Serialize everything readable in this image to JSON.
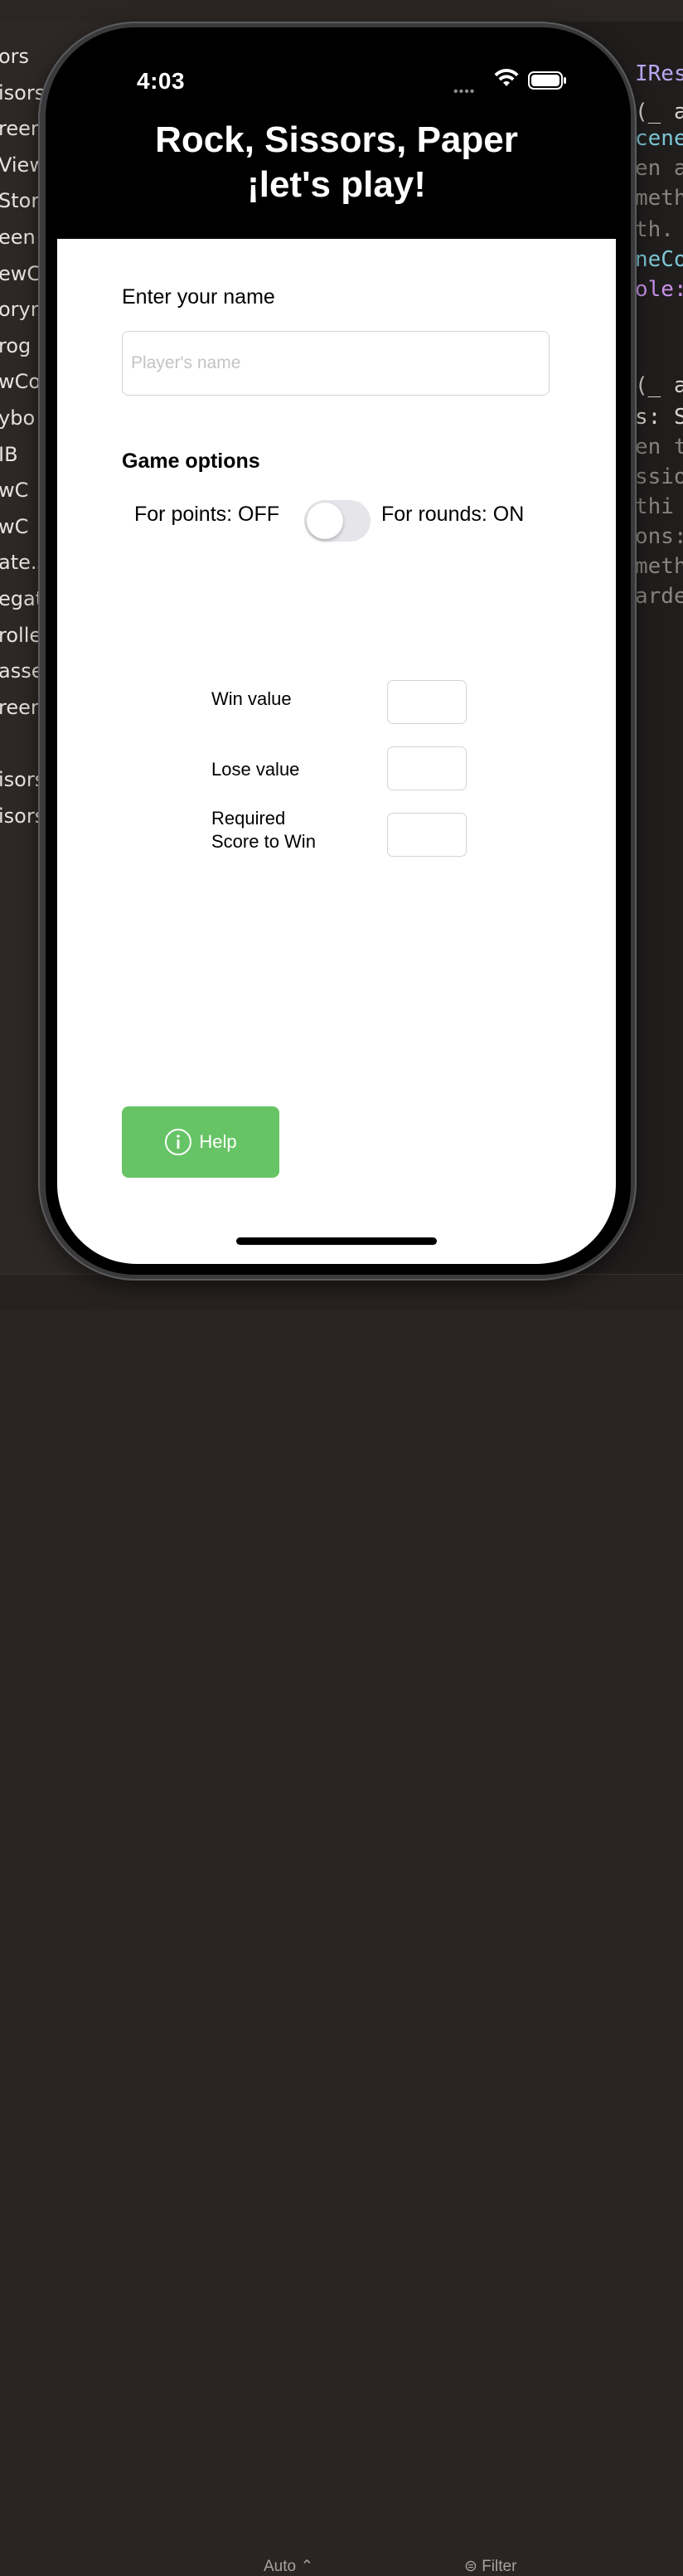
{
  "ide": {
    "file_items": [
      "ors",
      "isors",
      "reen",
      "View",
      "Story",
      "een",
      "ewC",
      "oryn",
      "rog",
      "wCo",
      "ybo",
      "IB",
      "wC",
      "wC",
      "ate.s",
      "egat",
      "rolle",
      "asse",
      "reen",
      "isors",
      "isors"
    ],
    "code_lines": [
      {
        "text": "IRes",
        "color": "#b8a7f2"
      },
      {
        "text": "(_ a",
        "color": "#d8d4d0"
      },
      {
        "text": "cene",
        "color": "#7cc7d6"
      },
      {
        "text": "en a",
        "color": "#8a8580"
      },
      {
        "text": "meth",
        "color": "#8a8580"
      },
      {
        "text": "th.",
        "color": "#8a8580"
      },
      {
        "text": "neCo",
        "color": "#7cc7d6"
      },
      {
        "text": "ole:",
        "color": "#c792ea"
      },
      {
        "text": "(_ a",
        "color": "#d8d4d0"
      },
      {
        "text": "s: S",
        "color": "#d8d4d0"
      },
      {
        "text": "en t",
        "color": "#8a8580"
      },
      {
        "text": "ssio",
        "color": "#8a8580"
      },
      {
        "text": "thi",
        "color": "#8a8580"
      },
      {
        "text": "ons:",
        "color": "#8a8580"
      },
      {
        "text": "meth",
        "color": "#8a8580"
      },
      {
        "text": "arde",
        "color": "#8a8580"
      }
    ],
    "bottom": {
      "auto_label": "Auto ⌃",
      "filter_label": "Filter"
    }
  },
  "status_bar": {
    "time": "4:03",
    "signal": "••••"
  },
  "header": {
    "title_line1": "Rock, Sissors, Paper",
    "title_line2": "¡let's play!"
  },
  "form": {
    "name_label": "Enter your name",
    "name_placeholder": "Player's name",
    "name_value": "",
    "options_title": "Game options",
    "points_label": "For points: OFF",
    "rounds_label": "For rounds: ON",
    "toggle_on": false,
    "fields": [
      {
        "label": "Win value",
        "value": ""
      },
      {
        "label": "Lose value",
        "value": ""
      },
      {
        "label": "Required\nScore to Win",
        "value": ""
      }
    ],
    "help_label": "Help"
  },
  "colors": {
    "help_button": "#67c466",
    "toggle_track": "#e5e5ea",
    "screen_bg": "#ffffff",
    "header_bg": "#000000"
  }
}
